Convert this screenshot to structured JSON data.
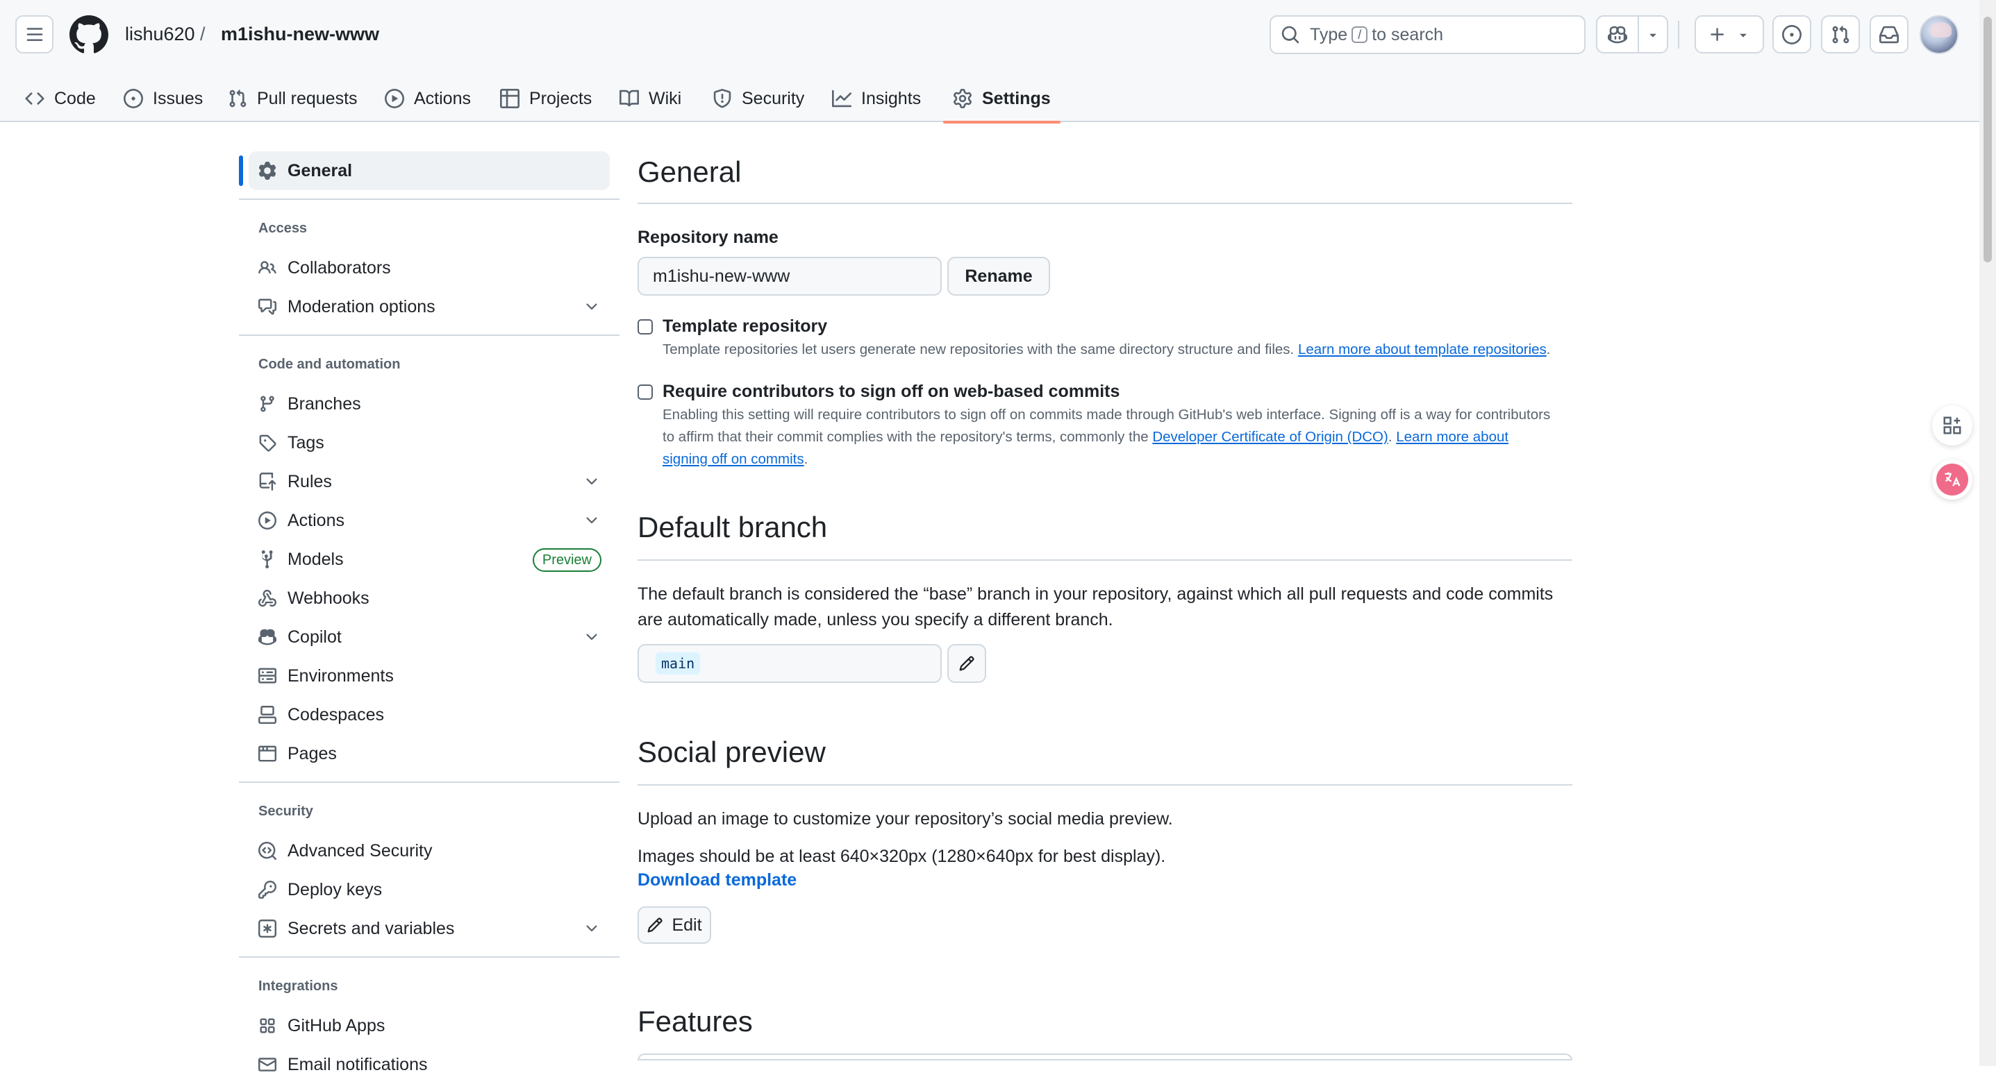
{
  "header": {
    "owner": "lishu620",
    "separator": "/",
    "repo": "m1ishu-new-www",
    "search": {
      "prefix": "Type",
      "key": "/",
      "suffix": "to search"
    }
  },
  "tabs": [
    {
      "label": "Code",
      "icon": "code-icon"
    },
    {
      "label": "Issues",
      "icon": "issue-icon"
    },
    {
      "label": "Pull requests",
      "icon": "pull-request-icon"
    },
    {
      "label": "Actions",
      "icon": "play-icon"
    },
    {
      "label": "Projects",
      "icon": "table-icon"
    },
    {
      "label": "Wiki",
      "icon": "book-icon"
    },
    {
      "label": "Security",
      "icon": "shield-icon"
    },
    {
      "label": "Insights",
      "icon": "graph-icon"
    },
    {
      "label": "Settings",
      "icon": "gear-icon",
      "active": true
    }
  ],
  "sidebar": {
    "general": "General",
    "groups": {
      "access": "Access",
      "code": "Code and automation",
      "security": "Security",
      "integrations": "Integrations"
    },
    "access_items": [
      "Collaborators",
      "Moderation options"
    ],
    "code_items": [
      "Branches",
      "Tags",
      "Rules",
      "Actions",
      "Models",
      "Webhooks",
      "Copilot",
      "Environments",
      "Codespaces",
      "Pages"
    ],
    "models_badge": "Preview",
    "security_items": [
      "Advanced Security",
      "Deploy keys",
      "Secrets and variables"
    ],
    "integration_items": [
      "GitHub Apps",
      "Email notifications"
    ]
  },
  "main": {
    "title": "General",
    "repo_name_label": "Repository name",
    "repo_name_value": "m1ishu-new-www",
    "rename_button": "Rename",
    "template": {
      "title": "Template repository",
      "note": "Template repositories let users generate new repositories with the same directory structure and files.",
      "link": "Learn more about template repositories",
      "tail": "."
    },
    "signoff": {
      "title": "Require contributors to sign off on web-based commits",
      "note": "Enabling this setting will require contributors to sign off on commits made through GitHub's web interface. Signing off is a way for contributors to affirm that their commit complies with the repository's terms, commonly the",
      "link1": "Developer Certificate of Origin (DCO)",
      "mid": ".",
      "link2": "Learn more about signing off on commits",
      "tail": "."
    },
    "default_branch": {
      "title": "Default branch",
      "text": "The default branch is considered the “base” branch in your repository, against which all pull requests and code commits are automatically made, unless you specify a different branch.",
      "value": "main"
    },
    "social": {
      "title": "Social preview",
      "text1": "Upload an image to customize your repository’s social media preview.",
      "text2": "Images should be at least 640×320px (1280×640px for best display).",
      "download": "Download template",
      "edit": "Edit"
    },
    "features_title": "Features"
  },
  "colors": {
    "accent": "#0969da",
    "active_tab_underline": "#fd8c73",
    "preview_badge": "#1a7f37",
    "border": "#d1d9e0"
  }
}
